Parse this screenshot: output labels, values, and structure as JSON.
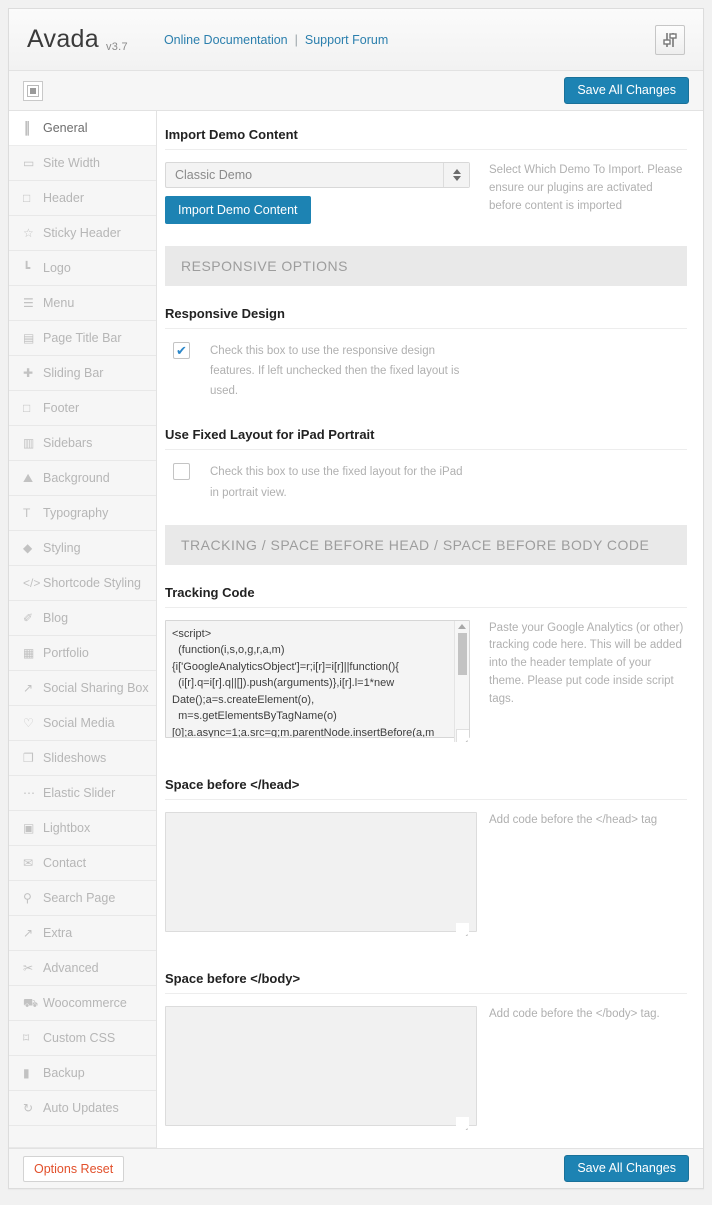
{
  "header": {
    "brand": "Avada",
    "version": "v3.7",
    "link_docs": "Online Documentation",
    "separator": "|",
    "link_forum": "Support Forum",
    "settings_icon": "sliders-icon",
    "accent_color": "#1d83b3",
    "link_color": "#2b7fad"
  },
  "toolbar": {
    "expand_icon": "square-panel-icon",
    "save_label": "Save All Changes"
  },
  "sidebar": {
    "items": [
      {
        "label": "General",
        "icon": "sliders-icon",
        "active": true
      },
      {
        "label": "Site Width",
        "icon": "rectangle-icon",
        "active": false
      },
      {
        "label": "Header",
        "icon": "square-outline-icon",
        "active": false
      },
      {
        "label": "Sticky Header",
        "icon": "star-icon",
        "active": false
      },
      {
        "label": "Logo",
        "icon": "corner-icon",
        "active": false
      },
      {
        "label": "Menu",
        "icon": "hamburger-icon",
        "active": false
      },
      {
        "label": "Page Title Bar",
        "icon": "window-icon",
        "active": false
      },
      {
        "label": "Sliding Bar",
        "icon": "plus-icon",
        "active": false
      },
      {
        "label": "Footer",
        "icon": "square-outline-icon",
        "active": false
      },
      {
        "label": "Sidebars",
        "icon": "columns-icon",
        "active": false
      },
      {
        "label": "Background",
        "icon": "image-icon",
        "active": false
      },
      {
        "label": "Typography",
        "icon": "text-t-icon",
        "active": false
      },
      {
        "label": "Styling",
        "icon": "droplet-icon",
        "active": false
      },
      {
        "label": "Shortcode Styling",
        "icon": "code-icon",
        "active": false
      },
      {
        "label": "Blog",
        "icon": "pen-icon",
        "active": false
      },
      {
        "label": "Portfolio",
        "icon": "grid-image-icon",
        "active": false
      },
      {
        "label": "Social Sharing Box",
        "icon": "share-icon",
        "active": false
      },
      {
        "label": "Social Media",
        "icon": "heart-icon",
        "active": false
      },
      {
        "label": "Slideshows",
        "icon": "slides-icon",
        "active": false
      },
      {
        "label": "Elastic Slider",
        "icon": "dots-icon",
        "active": false
      },
      {
        "label": "Lightbox",
        "icon": "photo-icon",
        "active": false
      },
      {
        "label": "Contact",
        "icon": "envelope-icon",
        "active": false
      },
      {
        "label": "Search Page",
        "icon": "search-icon",
        "active": false
      },
      {
        "label": "Extra",
        "icon": "external-link-icon",
        "active": false
      },
      {
        "label": "Advanced",
        "icon": "scissors-icon",
        "active": false
      },
      {
        "label": "Woocommerce",
        "icon": "cart-icon",
        "active": false
      },
      {
        "label": "Custom CSS",
        "icon": "css-icon",
        "active": false
      },
      {
        "label": "Backup",
        "icon": "database-icon",
        "active": false
      },
      {
        "label": "Auto Updates",
        "icon": "refresh-icon",
        "active": false
      }
    ]
  },
  "main": {
    "import_section": {
      "title": "Import Demo Content",
      "select_value": "Classic Demo",
      "button_label": "Import Demo Content",
      "description": "Select Which Demo To Import. Please ensure our plugins are activated before content is imported"
    },
    "responsive_band": "RESPONSIVE OPTIONS",
    "responsive_design": {
      "title": "Responsive Design",
      "checked": true,
      "checkmark": "✔",
      "description": "Check this box to use the responsive design features. If left unchecked then the fixed layout is used."
    },
    "fixed_layout": {
      "title": "Use Fixed Layout for iPad Portrait",
      "checked": false,
      "description": "Check this box to use the fixed layout for the iPad in portrait view."
    },
    "tracking_band": "TRACKING / SPACE BEFORE HEAD / SPACE BEFORE BODY CODE",
    "tracking_code": {
      "title": "Tracking Code",
      "value": "<script>\n  (function(i,s,o,g,r,a,m)\n{i['GoogleAnalyticsObject']=r;i[r]=i[r]||function(){\n  (i[r].q=i[r].q||[]).push(arguments)},i[r].l=1*new\nDate();a=s.createElement(o),\n  m=s.getElementsByTagName(o)\n[0];a.async=1;a.src=g;m.parentNode.insertBefore(a,m\n)",
      "description": "Paste your Google Analytics (or other) tracking code here. This will be added into the header template of your theme. Please put code inside script tags."
    },
    "space_head": {
      "title": "Space before </head>",
      "value": "",
      "description": "Add code before the </head> tag"
    },
    "space_body": {
      "title": "Space before </body>",
      "value": "",
      "description": "Add code before the </body> tag."
    }
  },
  "footer": {
    "reset_label": "Options Reset",
    "save_label": "Save All Changes",
    "reset_color": "#e2502b"
  }
}
